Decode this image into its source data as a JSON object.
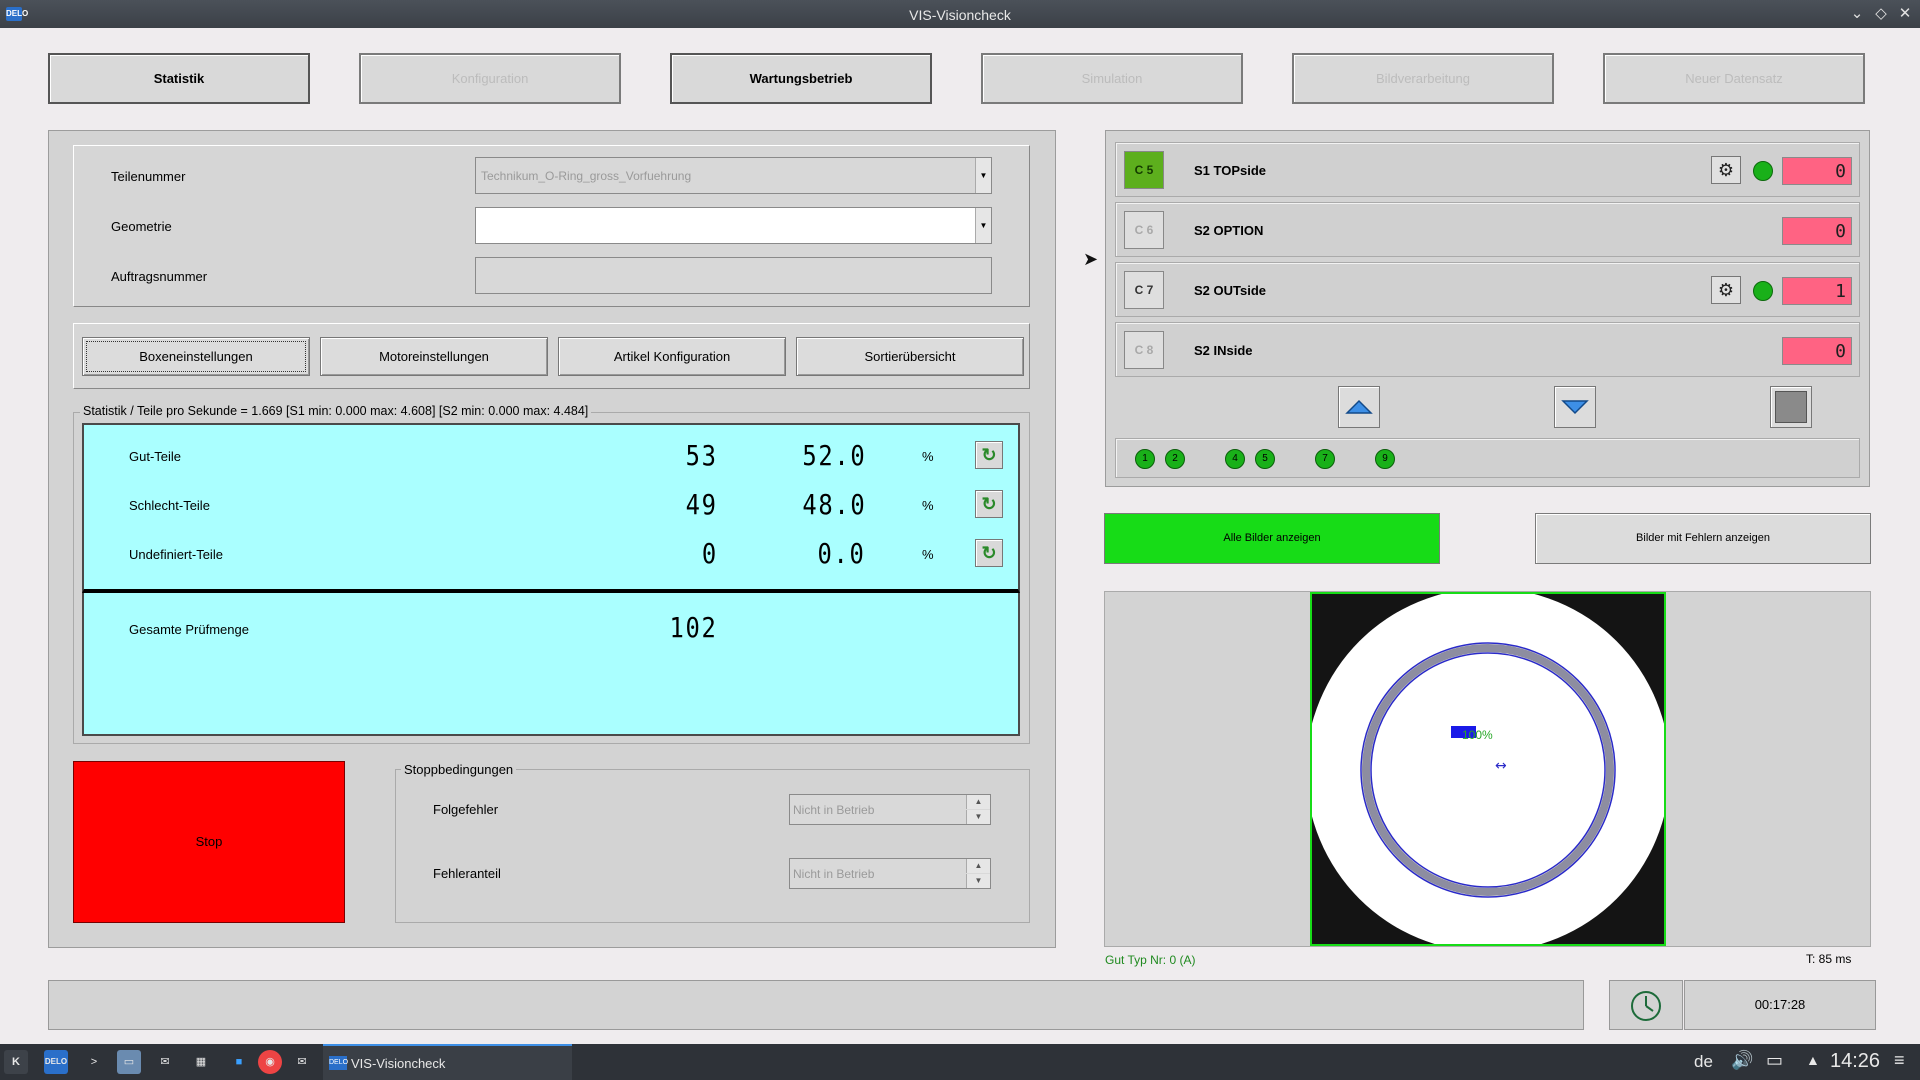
{
  "window": {
    "title": "VIS-Visioncheck",
    "app_icon": "DELO"
  },
  "top_buttons": [
    {
      "label": "Statistik",
      "enabled": true
    },
    {
      "label": "Konfiguration",
      "enabled": false
    },
    {
      "label": "Wartungsbetrieb",
      "enabled": true
    },
    {
      "label": "Simulation",
      "enabled": false
    },
    {
      "label": "Bildverarbeitung",
      "enabled": false
    },
    {
      "label": "Neuer Datensatz",
      "enabled": false
    }
  ],
  "form": {
    "teilenummer_label": "Teilenummer",
    "teilenummer_value": "Technikum_O-Ring_gross_Vorfuehrung",
    "geometrie_label": "Geometrie",
    "geometrie_value": "",
    "auftragsnummer_label": "Auftragsnummer",
    "auftragsnummer_value": ""
  },
  "settings_buttons": {
    "box": "Boxeneinstellungen",
    "motor": "Motoreinstellungen",
    "artikel": "Artikel Konfiguration",
    "sortier": "Sortierübersicht"
  },
  "statistics": {
    "header": "Statistik / Teile pro Sekunde = 1.669 [S1 min: 0.000 max: 4.608]  [S2 min: 0.000 max: 4.484]",
    "rows": [
      {
        "label": "Gut-Teile",
        "count": "53",
        "percent": "52.0",
        "unit": "%"
      },
      {
        "label": "Schlecht-Teile",
        "count": "49",
        "percent": "48.0",
        "unit": "%"
      },
      {
        "label": "Undefiniert-Teile",
        "count": "0",
        "percent": "0.0",
        "unit": "%"
      }
    ],
    "total_label": "Gesamte Prüfmenge",
    "total_value": "102"
  },
  "stop": {
    "button_label": "Stop",
    "conditions_title": "Stoppbedingungen",
    "folgefehler_label": "Folgefehler",
    "folgefehler_value": "Nicht in Betrieb",
    "fehleranteil_label": "Fehleranteil",
    "fehleranteil_value": "Nicht in Betrieb"
  },
  "cameras": [
    {
      "id": "C 5",
      "name": "S1 TOPside",
      "active": true,
      "has_settings": true,
      "status_color": "#19b019",
      "counter": "0"
    },
    {
      "id": "C 6",
      "name": "S2 OPTION",
      "active": false,
      "has_settings": false,
      "counter": "0"
    },
    {
      "id": "C 7",
      "name": "S2 OUTside",
      "active": false,
      "has_settings": true,
      "status_color": "#19b019",
      "counter": "1"
    },
    {
      "id": "C 8",
      "name": "S2 INside",
      "active": false,
      "has_settings": false,
      "counter": "0"
    }
  ],
  "indicator_dots": [
    "1",
    "2",
    "4",
    "5",
    "7",
    "9"
  ],
  "image_buttons": {
    "all": "Alle Bilder anzeigen",
    "errors": "Bilder mit Fehlern anzeigen"
  },
  "image_view": {
    "overlay_text": "100%",
    "type_text": "Gut Typ Nr: 0 (A)",
    "time_text": "T: 85 ms"
  },
  "status_bar": {
    "timer": "00:17:28"
  },
  "taskbar": {
    "task_label": "VIS-Visioncheck",
    "keyboard_layout": "de",
    "clock": "14:26"
  },
  "colors": {
    "accent_green": "#17dc17",
    "stop_red": "#ff0000",
    "stats_bg": "#aaffff",
    "counter_pink": "#ff6383"
  }
}
